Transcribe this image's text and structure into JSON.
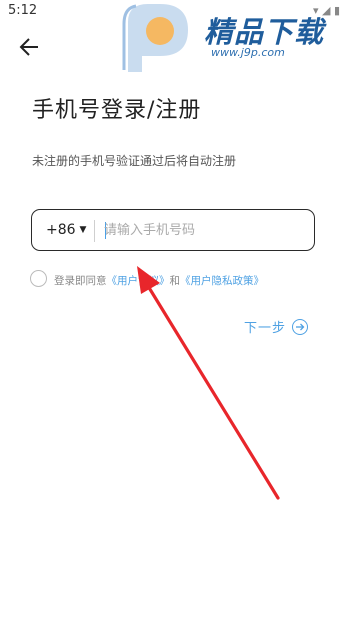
{
  "status_bar": {
    "time": "5:12"
  },
  "watermark": {
    "brand": "精品下载",
    "url": "www.j9p.com",
    "accent_color": "#1f5d9c"
  },
  "header": {
    "back_icon": "arrow-left-icon"
  },
  "login": {
    "title": "手机号登录/注册",
    "subtitle": "未注册的手机号验证通过后将自动注册",
    "country_code": "+86",
    "phone_placeholder": "请输入手机号码",
    "phone_value": ""
  },
  "agreement": {
    "prefix": "登录即同意",
    "user_agreement": "《用户协议》",
    "and": "和",
    "privacy_policy": "《用户隐私政策》",
    "checked": false
  },
  "next": {
    "label": "下一步",
    "icon": "arrow-right-circle-icon"
  },
  "colors": {
    "link": "#4ea1e3",
    "annotation_arrow": "#e8262b"
  }
}
